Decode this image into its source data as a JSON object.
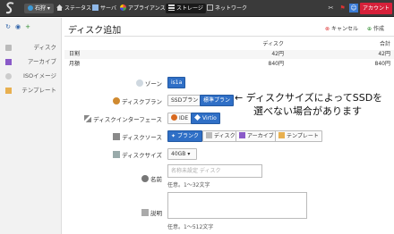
{
  "topbar": {
    "zone": "石狩",
    "nav": [
      {
        "label": "ステータス",
        "icon": "home-icon"
      },
      {
        "label": "サーバ",
        "icon": "server-icon"
      },
      {
        "label": "アプライアンス",
        "icon": "appliance-icon"
      },
      {
        "label": "ストレージ",
        "icon": "storage-icon"
      },
      {
        "label": "ネットワーク",
        "icon": "network-icon"
      }
    ],
    "account": "アカウント"
  },
  "sidebar": {
    "items": [
      {
        "label": "ディスク",
        "icon": "disk-icon"
      },
      {
        "label": "アーカイブ",
        "icon": "archive-icon"
      },
      {
        "label": "ISOイメージ",
        "icon": "iso-icon"
      },
      {
        "label": "テンプレート",
        "icon": "template-icon"
      }
    ]
  },
  "header": {
    "title": "ディスク追加",
    "cancel": "キャンセル",
    "create": "作成"
  },
  "price": {
    "head": [
      "",
      "ディスク",
      "合計"
    ],
    "rows": [
      [
        "日割",
        "42円",
        "42円"
      ],
      [
        "月額",
        "840円",
        "840円"
      ]
    ]
  },
  "form": {
    "zone_label": "ゾーン",
    "zone_value": "is1a",
    "plan_label": "ディスクプラン",
    "plan_options": [
      "SSDプラン",
      "標準プラン"
    ],
    "annotation": [
      "← ディスクサイズによってSSDを",
      "選べない場合があります"
    ],
    "iface_label": "ディスクインターフェース",
    "iface_options": [
      "IDE",
      "Virtio"
    ],
    "source_label": "ディスクソース",
    "source_options": [
      "ブランク",
      "ディスク",
      "アーカイブ",
      "テンプレート"
    ],
    "size_label": "ディスクサイズ",
    "size_value": "40GB",
    "name_label": "名前",
    "name_placeholder": "名称未設定 ディスク",
    "name_hint": "任意。1～32文字",
    "desc_label": "説明",
    "desc_hint": "任意。1～512文字"
  },
  "colors": {
    "accent": "#2f6fc6",
    "topbar": "#3a3a3a",
    "account": "#d6213a"
  }
}
